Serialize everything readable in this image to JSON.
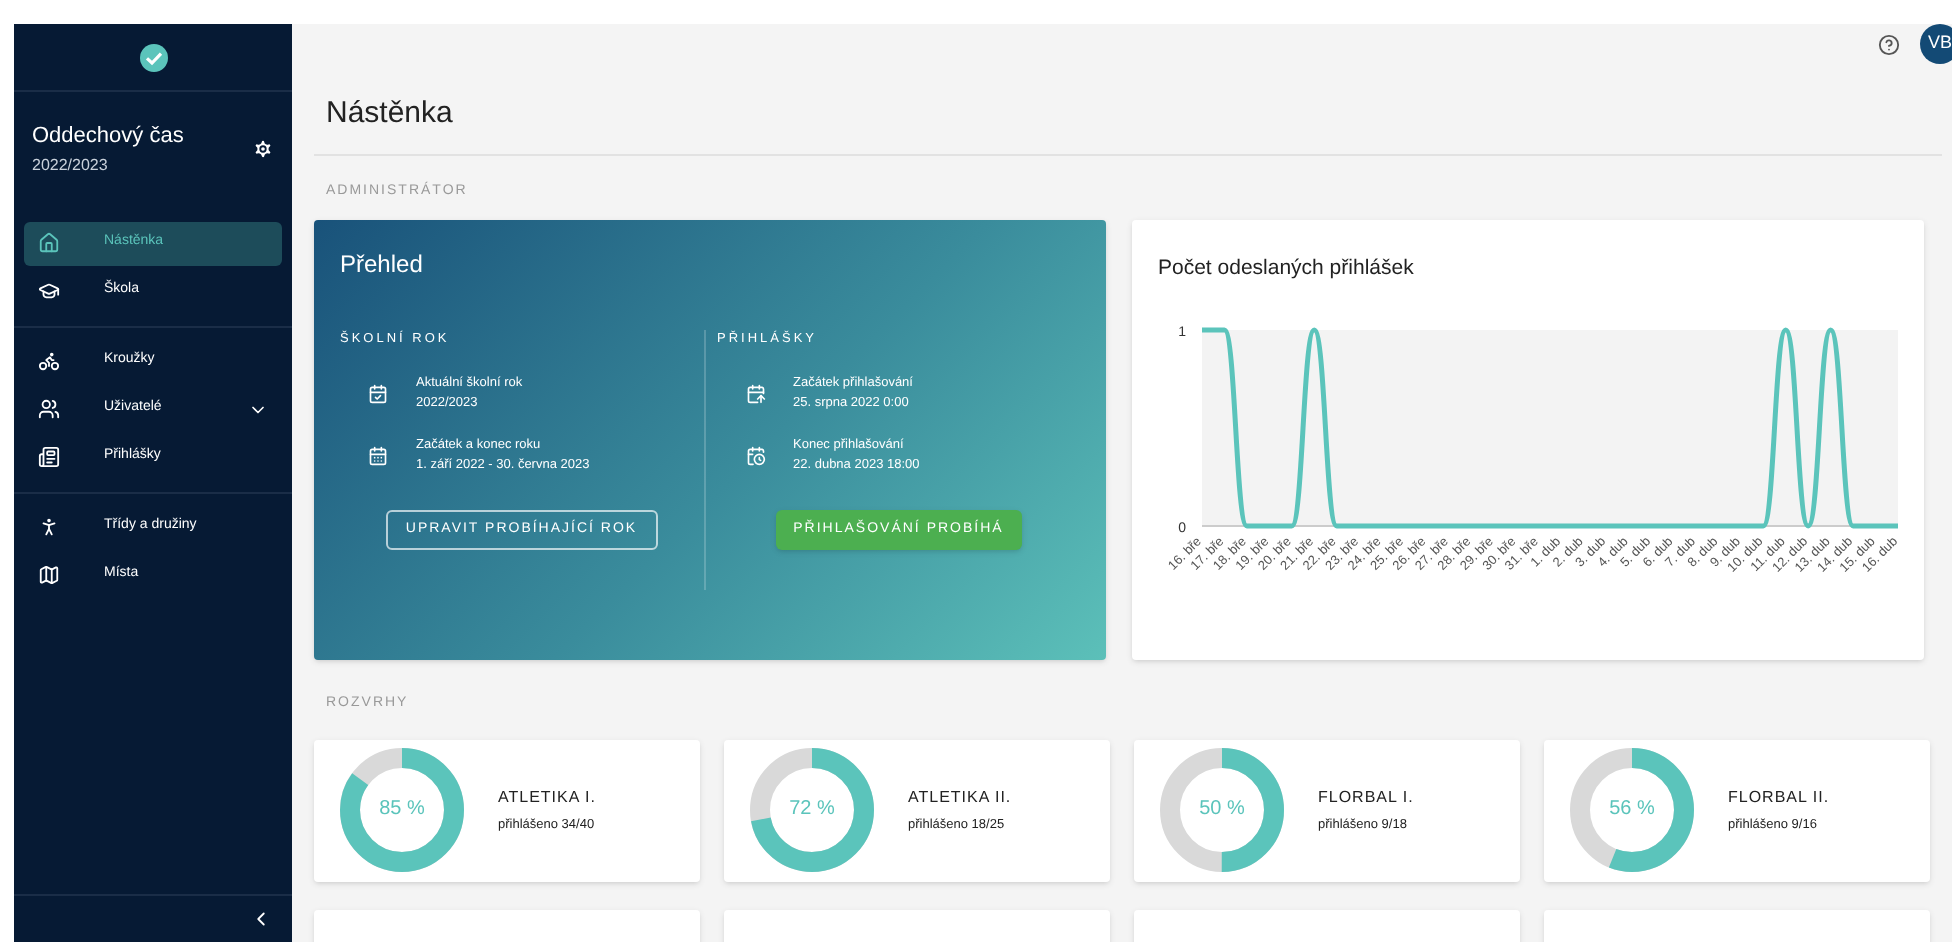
{
  "sidebar": {
    "org_name": "Oddechový čas",
    "org_year": "2022/2023",
    "groups": [
      [
        {
          "label": "Nástěnka",
          "selected": true,
          "submenu": false
        },
        {
          "label": "Škola",
          "selected": false,
          "submenu": false
        }
      ],
      [
        {
          "label": "Kroužky",
          "selected": false,
          "submenu": false
        },
        {
          "label": "Uživatelé",
          "selected": false,
          "submenu": true
        },
        {
          "label": "Přihlášky",
          "selected": false,
          "submenu": false
        }
      ],
      [
        {
          "label": "Třídy a družiny",
          "selected": false,
          "submenu": false
        },
        {
          "label": "Místa",
          "selected": false,
          "submenu": false
        }
      ]
    ]
  },
  "header": {
    "avatar": "VB"
  },
  "page_title": "Nástěnka",
  "admin_section": {
    "label": "ADMINISTRÁTOR",
    "overview": {
      "title": "Přehled",
      "columns": [
        {
          "heading": "ŠKOLNÍ ROK",
          "rows": [
            {
              "label": "Aktuální školní rok",
              "value": "2022/2023"
            },
            {
              "label": "Začátek a konec roku",
              "value": "1. září 2022 - 30. června 2023"
            }
          ],
          "button": {
            "label": "UPRAVIT PROBÍHAJÍCÍ ROK",
            "kind": "outlined"
          }
        },
        {
          "heading": "PŘIHLÁŠKY",
          "rows": [
            {
              "label": "Začátek přihlašování",
              "value": "25. srpna 2022 0:00"
            },
            {
              "label": "Konec přihlašování",
              "value": "22. dubna 2023 18:00"
            }
          ],
          "button": {
            "label": "PŘIHLAŠOVÁNÍ PROBÍHÁ",
            "kind": "filled"
          }
        }
      ]
    },
    "chart_card": {
      "title": "Počet odeslaných přihlášek",
      "chart_data": {
        "type": "line",
        "categories": [
          "16. bře",
          "17. bře",
          "18. bře",
          "19. bře",
          "20. bře",
          "21. bře",
          "22. bře",
          "23. bře",
          "24. bře",
          "25. bře",
          "26. bře",
          "27. bře",
          "28. bře",
          "29. bře",
          "30. bře",
          "31. bře",
          "1. dub",
          "2. dub",
          "3. dub",
          "4. dub",
          "5. dub",
          "6. dub",
          "7. dub",
          "8. dub",
          "9. dub",
          "10. dub",
          "11. dub",
          "12. dub",
          "13. dub",
          "14. dub",
          "15. dub",
          "16. dub"
        ],
        "series": [
          {
            "color": "#5bc4bb",
            "values": [
              1,
              1,
              0,
              0,
              0,
              1,
              0,
              0,
              0,
              0,
              0,
              0,
              0,
              0,
              0,
              0,
              0,
              0,
              0,
              0,
              0,
              0,
              0,
              0,
              0,
              0,
              1,
              0,
              1,
              0,
              0,
              0
            ]
          }
        ],
        "ylim": [
          0,
          1
        ],
        "yticks": [
          0,
          1
        ]
      }
    }
  },
  "schedules": {
    "label": "ROZVRHY",
    "cards": [
      {
        "name": "ATLETIKA I.",
        "percent": "85 %",
        "level": 0.85,
        "registered": "přihlášeno 34/40"
      },
      {
        "name": "ATLETIKA II.",
        "percent": "72 %",
        "level": 0.72,
        "registered": "přihlášeno 18/25"
      },
      {
        "name": "FLORBAL I.",
        "percent": "50 %",
        "level": 0.5,
        "registered": "přihlášeno 9/18"
      },
      {
        "name": "FLORBAL II.",
        "percent": "56 %",
        "level": 0.56,
        "registered": "přihlášeno 9/16"
      }
    ]
  }
}
